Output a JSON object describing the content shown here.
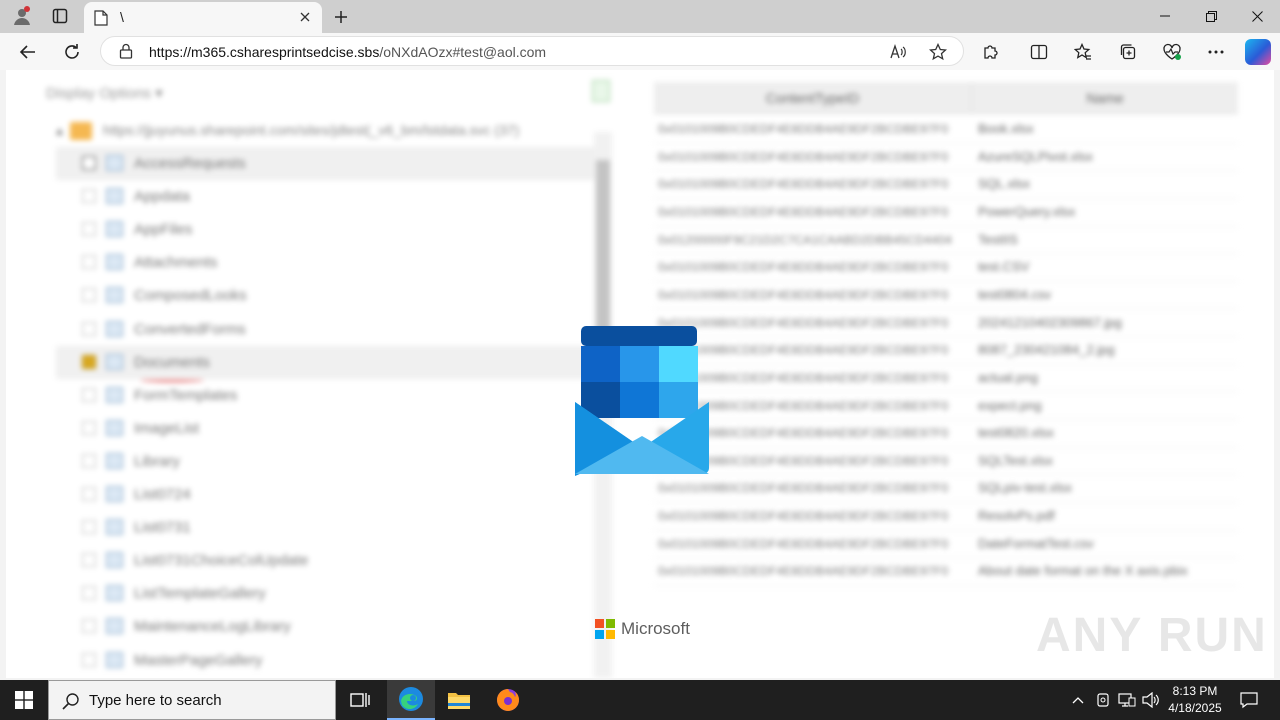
{
  "browser": {
    "tab_title": "\\",
    "url_host": "https://m365.csharesprintsedcise.sbs",
    "url_path": "/oNXdAOzx#test@aol.com"
  },
  "page": {
    "display_options": "Display Options",
    "site_url": "https://jjuyunus.sharepoint.com/sites/jdtest(_v6_bm/lstdata.svc (37)",
    "tree_items": [
      "AccessRequests",
      "Appdata",
      "AppFiles",
      "Attachments",
      "ComposedLooks",
      "ConvertedForms",
      "Documents",
      "FormTemplates",
      "ImageList",
      "Library",
      "List0724",
      "List0731",
      "List0731ChoiceColUpdate",
      "ListTemplateGallery",
      "MaintenanceLogLibrary",
      "MasterPageGallery"
    ],
    "grid_headers": [
      "ContentTypeID",
      "Name"
    ],
    "content_type_id": "0x0101009B0CDEDF4E8DDB4AE9DF2BCDBE97F0",
    "content_type_id_alt": "0x01200000F9C21D2C7CA1CAABD2DBB45CD4404",
    "file_names": [
      "Book.xlsx",
      "AzureSQLPivot.xlsx",
      "SQL.xlsx",
      "PowerQuery.xlsx",
      "TestIIS",
      "test.CSV",
      "test0804.csv",
      "20241210402309867.jpg",
      "8087_230421084_2.jpg",
      "actual.png",
      "expect.png",
      "test0820.xlsx",
      "SQLTest.xlsx",
      "SQLpiv-test.xlsx",
      "ResolvPs.pdf",
      "DateFormatTest.csv",
      "About date format on the X axis.pbix"
    ],
    "brand": "Microsoft",
    "watermark": "ANY RUN"
  },
  "taskbar": {
    "search_placeholder": "Type here to search",
    "time": "8:13 PM",
    "date": "4/18/2025"
  }
}
